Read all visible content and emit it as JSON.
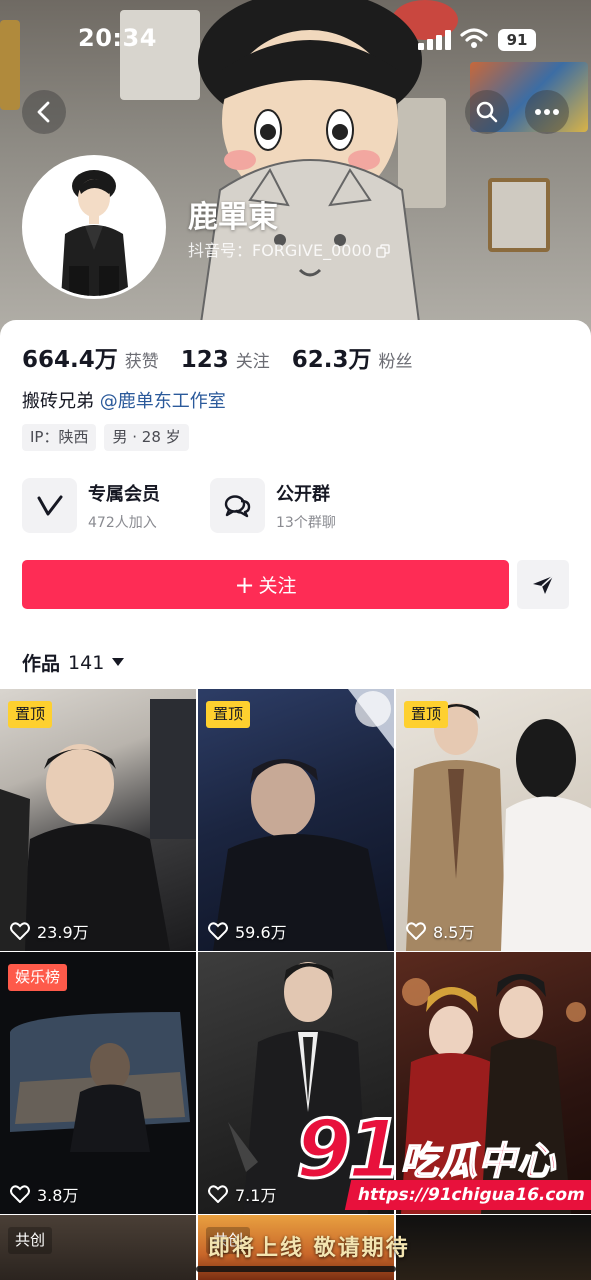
{
  "status_bar": {
    "time": "20:34",
    "battery": "91"
  },
  "profile": {
    "nickname": "鹿單東",
    "douyin_id": "抖音号：FORGIVE_0000",
    "stats": [
      {
        "value": "664.4万",
        "label": "获赞"
      },
      {
        "value": "123",
        "label": "关注"
      },
      {
        "value": "62.3万",
        "label": "粉丝"
      }
    ],
    "bio_text": "搬砖兄弟 ",
    "bio_mention": "@鹿单东工作室",
    "tags": [
      "IP：陕西",
      "男 · 28 岁"
    ]
  },
  "features": {
    "vip": {
      "title": "专属会员",
      "subtitle": "472人加入",
      "icon": "v-logo-icon"
    },
    "group": {
      "title": "公开群",
      "subtitle": "13个群聊",
      "icon": "chat-bubbles-icon"
    }
  },
  "actions": {
    "follow_plus": "+",
    "follow_label": "关注"
  },
  "works": {
    "label": "作品",
    "count": "141"
  },
  "videos": [
    {
      "badge": "置顶",
      "badge_type": "pin",
      "likes": "23.9万"
    },
    {
      "badge": "置顶",
      "badge_type": "pin",
      "likes": "59.6万"
    },
    {
      "badge": "置顶",
      "badge_type": "pin",
      "likes": "8.5万"
    },
    {
      "badge": "娱乐榜",
      "badge_type": "ent",
      "likes": "3.8万"
    },
    {
      "badge": "",
      "badge_type": "",
      "likes": "7.1万"
    },
    {
      "badge": "",
      "badge_type": "",
      "likes": ""
    },
    {
      "badge": "共创",
      "badge_type": "co",
      "likes": ""
    },
    {
      "badge": "共创",
      "badge_type": "co",
      "likes": ""
    },
    {
      "badge": "",
      "badge_type": "",
      "likes": ""
    }
  ],
  "overlay": {
    "watermark_number": "91",
    "watermark_text": "吃瓜中心",
    "watermark_url": "https://91chigua16.com",
    "video_caption": "即将上线 敬请期待"
  },
  "colors": {
    "accent": "#fe2c55",
    "pin_badge": "#fed02f",
    "mention": "#2b5a9b",
    "watermark": "#e8113c"
  }
}
